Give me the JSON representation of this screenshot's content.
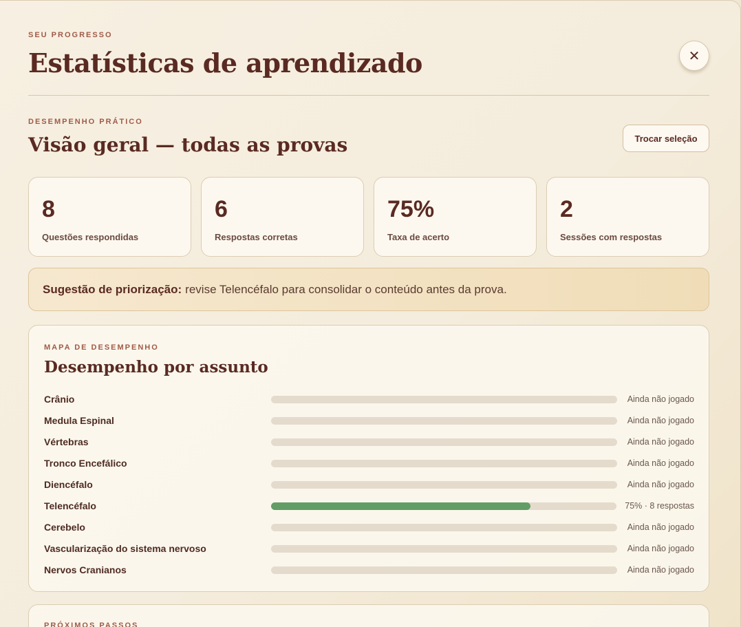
{
  "header": {
    "eyebrow": "SEU PROGRESSO",
    "title": "Estatísticas de aprendizado",
    "close_label": "✕"
  },
  "overview": {
    "eyebrow": "DESEMPENHO PRÁTICO",
    "title": "Visão geral — todas as provas",
    "swap_button": "Trocar seleção"
  },
  "stats": [
    {
      "value": "8",
      "label": "Questões respondidas"
    },
    {
      "value": "6",
      "label": "Respostas corretas"
    },
    {
      "value": "75%",
      "label": "Taxa de acerto"
    },
    {
      "value": "2",
      "label": "Sessões com respostas"
    }
  ],
  "suggestion": {
    "label": "Sugestão de priorização:",
    "text": "revise Telencéfalo para consolidar o conteúdo antes da prova."
  },
  "performance_map": {
    "eyebrow": "MAPA DE DESEMPENHO",
    "title": "Desempenho por assunto",
    "topics": [
      {
        "name": "Crânio",
        "progress": 0,
        "status": "Ainda não jogado"
      },
      {
        "name": "Medula Espinal",
        "progress": 0,
        "status": "Ainda não jogado"
      },
      {
        "name": "Vértebras",
        "progress": 0,
        "status": "Ainda não jogado"
      },
      {
        "name": "Tronco Encefálico",
        "progress": 0,
        "status": "Ainda não jogado"
      },
      {
        "name": "Diencéfalo",
        "progress": 0,
        "status": "Ainda não jogado"
      },
      {
        "name": "Telencéfalo",
        "progress": 0.75,
        "status": "75% · 8 respostas"
      },
      {
        "name": "Cerebelo",
        "progress": 0,
        "status": "Ainda não jogado"
      },
      {
        "name": "Vascularização do sistema nervoso",
        "progress": 0,
        "status": "Ainda não jogado"
      },
      {
        "name": "Nervos Cranianos",
        "progress": 0,
        "status": "Ainda não jogado"
      }
    ]
  },
  "next_steps": {
    "eyebrow": "PRÓXIMOS PASSOS"
  },
  "colors": {
    "accent": "#5a2a22",
    "progress_fill": "#629d66",
    "track": "#e4dbcd"
  }
}
